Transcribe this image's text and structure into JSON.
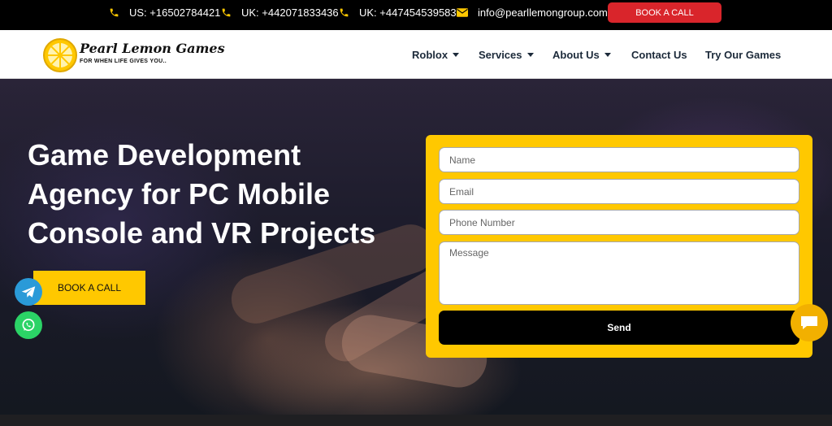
{
  "topbar": {
    "contacts": [
      {
        "icon": "phone-icon",
        "text": "US: +16502784421"
      },
      {
        "icon": "phone-icon",
        "text": "UK: +442071833436"
      },
      {
        "icon": "phone-icon",
        "text": "UK: +447454539583"
      },
      {
        "icon": "mail-icon",
        "text": "info@pearllemongroup.com"
      }
    ],
    "cta_label": "BOOK A CALL",
    "cta_color": "#d9252b",
    "icon_color": "#ffc800"
  },
  "header": {
    "logo_title": "Pearl Lemon Games",
    "logo_tagline": "FOR WHEN LIFE GIVES YOU..",
    "nav": [
      {
        "label": "Roblox",
        "dropdown": true
      },
      {
        "label": "Services",
        "dropdown": true
      },
      {
        "label": "About Us",
        "dropdown": true
      },
      {
        "label": "Contact Us",
        "dropdown": false
      },
      {
        "label": "Try Our Games",
        "dropdown": false
      }
    ]
  },
  "hero": {
    "headline_lines": [
      "Game Development",
      "Agency for PC Mobile",
      "Console and VR Projects"
    ],
    "cta_label": "BOOK A CALL",
    "accent_color": "#ffc800"
  },
  "form": {
    "name_placeholder": "Name",
    "email_placeholder": "Email",
    "phone_placeholder": "Phone Number",
    "message_placeholder": "Message",
    "send_label": "Send"
  },
  "floating": {
    "telegram_icon": "telegram-icon",
    "whatsapp_icon": "whatsapp-icon",
    "chat_icon": "chat-icon"
  }
}
